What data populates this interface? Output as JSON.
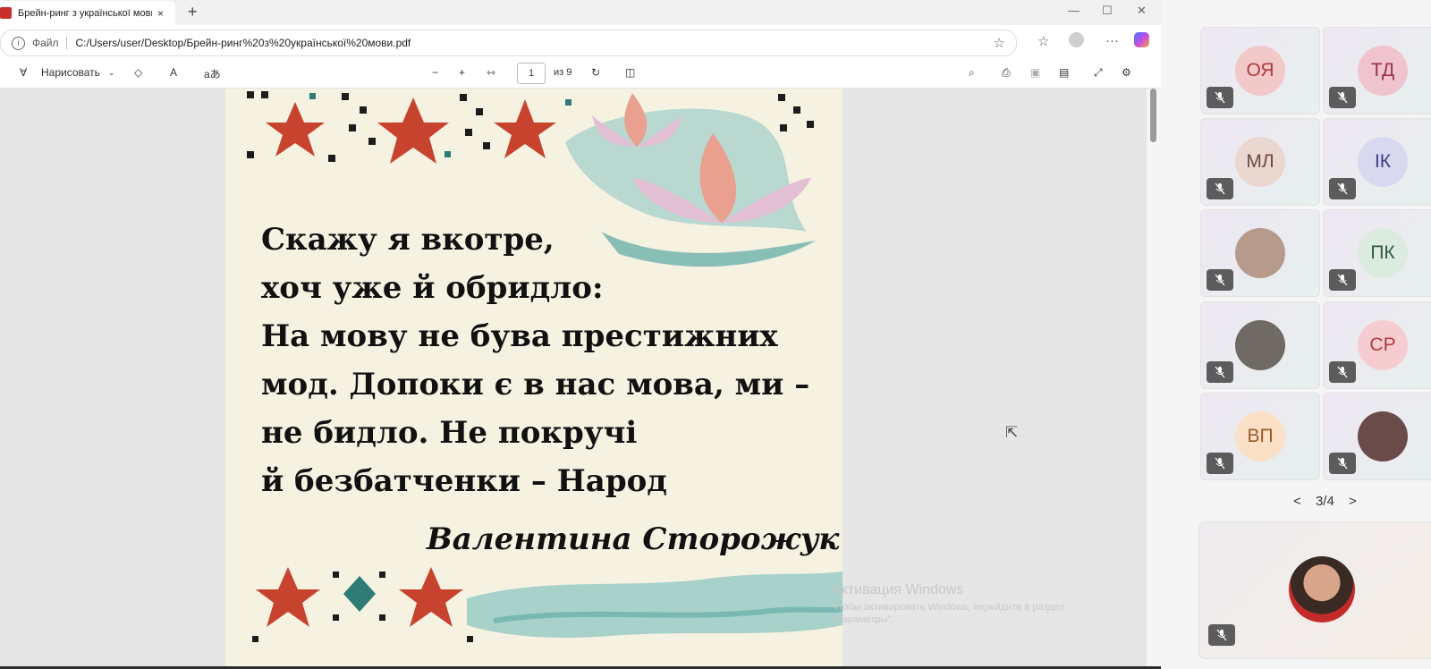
{
  "browser": {
    "tab_title": "Брейн-ринг з української мови.pdf",
    "tab_close": "×",
    "new_tab": "+",
    "window_controls": [
      "—",
      "☐",
      "✕"
    ],
    "address": {
      "info_icon": "i",
      "file_label": "Файл",
      "url": "C:/Users/user/Desktop/Брейн-ринг%20з%20української%20мови.pdf"
    }
  },
  "pdf_toolbar": {
    "draw_label": "Нарисовать",
    "text_read": "A",
    "translate": "aあ",
    "zoom_out": "−",
    "zoom_in": "+",
    "page_current": "1",
    "page_total": "из 9"
  },
  "document": {
    "poem_lines": [
      "Скажу я вкотре,",
      "хоч уже й обридло:",
      "На мову не бува престижних",
      "мод. Допоки є в нас мова, ми –",
      "не бидло. Не покручі",
      "й безбатченки – Народ"
    ],
    "author": "Валентина  Сторожук"
  },
  "watermark": {
    "title": "Активация Windows",
    "line1": "Чтобы активировать Windows, перейдите в раздел",
    "line2": "\"Параметры\"."
  },
  "participants": [
    {
      "initials": "ОЯ",
      "color": "#f2c9c9",
      "text_color": "#b03a3a"
    },
    {
      "initials": "ТД",
      "color": "#f0c4cf",
      "text_color": "#9a3146"
    },
    {
      "initials": "МЛ",
      "color": "#ead7d0",
      "text_color": "#6b4a3e"
    },
    {
      "initials": "ІК",
      "color": "#d8d9ef",
      "text_color": "#3c3f8a"
    },
    {
      "initials": "",
      "color": "#b69a8c",
      "text_color": "#333"
    },
    {
      "initials": "ПК",
      "color": "#dcebe0",
      "text_color": "#2f5a3c"
    },
    {
      "initials": "",
      "color": "#6f6a63",
      "text_color": "#333"
    },
    {
      "initials": "СР",
      "color": "#f5cdd0",
      "text_color": "#b03a44"
    },
    {
      "initials": "ВП",
      "color": "#fbe0c8",
      "text_color": "#9a5a26"
    },
    {
      "initials": "",
      "color": "#6b4a4a",
      "text_color": "#333"
    }
  ],
  "pager": {
    "prev": "<",
    "label": "3/4",
    "next": ">"
  },
  "colors": {
    "ukr_red": "#c8432e",
    "teal": "#8cc5c0",
    "lotus": "#e9a08f"
  }
}
